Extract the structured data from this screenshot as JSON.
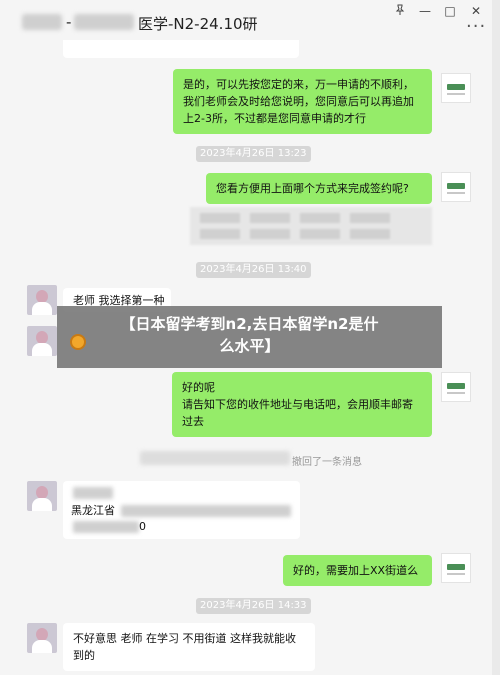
{
  "window": {
    "title": "医学-N2-24.10研",
    "title_prefix_dash": "-",
    "pin_icon": "pin-icon",
    "minimize_label": "—",
    "maximize_label": "□",
    "close_label": "✕",
    "more_label": "···"
  },
  "timestamps": [
    "2023年4月26日 13:23",
    "2023年4月26日 13:40",
    "2023年4月26日 14:33"
  ],
  "messages": {
    "m1_lines": [
      "是的，可以先按您定的来，万一申请的不顺利，",
      "我们老师会及时给您说明，您同意后可以再追加",
      "上2-3所，不过都是您同意申请的才行"
    ],
    "m2": "您看方便用上面哪个方式来完成签约呢?",
    "m3": "老师 我选择第一种",
    "m4_lines": [
      "好的呢",
      "请告知下您的收件地址与电话吧，会用顺丰邮寄",
      "过去"
    ],
    "m5_province": "黑龙江省",
    "m5_tail": "0",
    "m6": "好的，需要加上XX街道么",
    "m7_lines": [
      "不好意思 老师 在学习 不用街道 这样我就能收",
      "到的"
    ]
  },
  "recall_text": "撤回了一条消息",
  "banner": {
    "lines": [
      "【日本留学考到n2,去日本留学n2是什",
      "么水平】"
    ]
  }
}
